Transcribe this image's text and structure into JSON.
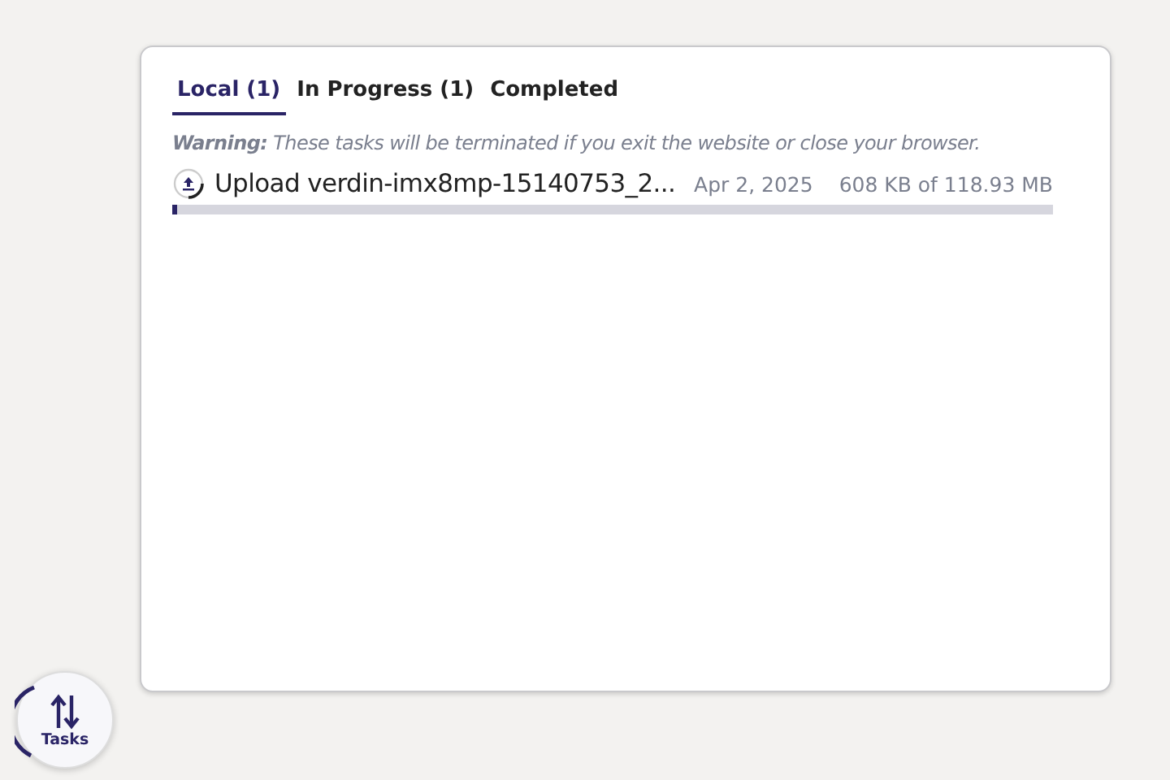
{
  "tabs": [
    {
      "label": "Local (1)",
      "selected": true
    },
    {
      "label": "In Progress (1)",
      "selected": false
    },
    {
      "label": "Completed",
      "selected": false
    }
  ],
  "warning": "**Warning:** These tasks will be terminated if you exit the website or close your browser.",
  "tasks": [
    {
      "name": "Upload verdin-imx8mp-15140753_2...",
      "date": "Apr 2, 2025",
      "size": "608 KB of 118.93 MB",
      "level": 0.005
    }
  ],
  "tasks_button": {
    "label": "Tasks"
  }
}
